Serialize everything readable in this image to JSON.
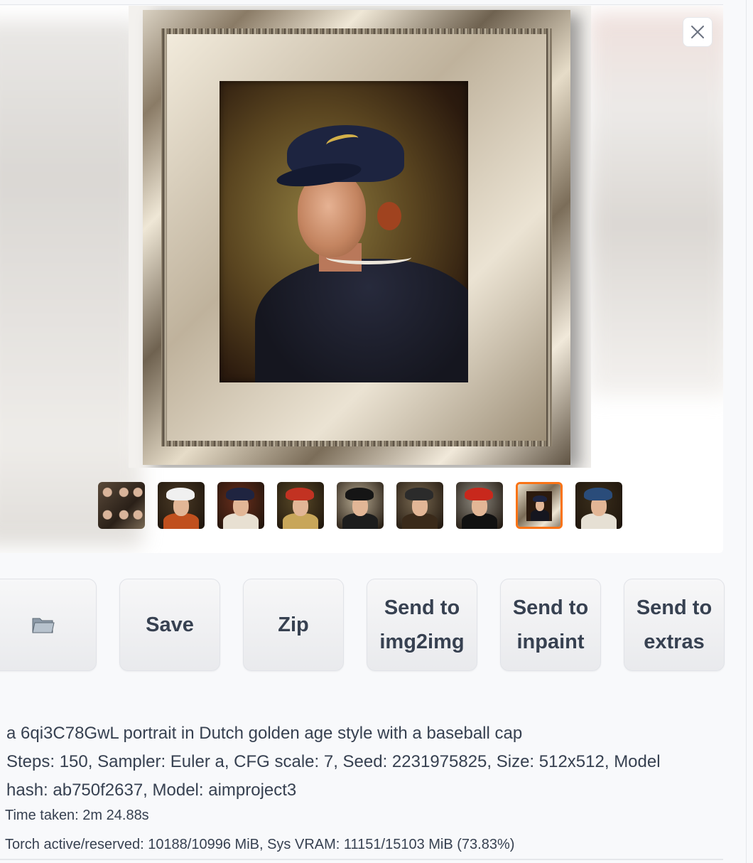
{
  "gallery": {
    "close_label": "close",
    "thumbnails": [
      {
        "kind": "grid",
        "hat_color": "",
        "body_color": "",
        "bg": "#3a2e22"
      },
      {
        "kind": "portrait",
        "hat_color": "#f0f0f0",
        "body_color": "#c0501e",
        "bg": "#4a3a26"
      },
      {
        "kind": "portrait",
        "hat_color": "#1f2440",
        "body_color": "#e8e0d2",
        "bg": "#6a2e1c"
      },
      {
        "kind": "portrait",
        "hat_color": "#c23222",
        "body_color": "#c8a65a",
        "bg": "#5a4a28"
      },
      {
        "kind": "portrait",
        "hat_color": "#151515",
        "body_color": "#1d1d1d",
        "bg": "#b8ab92"
      },
      {
        "kind": "portrait",
        "hat_color": "#2b2b2b",
        "body_color": "#3a2a1a",
        "bg": "#7a6a52"
      },
      {
        "kind": "portrait",
        "hat_color": "#c8281c",
        "body_color": "#111111",
        "bg": "#8e8a80"
      },
      {
        "kind": "frame",
        "hat_color": "#1d2440",
        "body_color": "#15161f",
        "bg": "#8a7b66",
        "selected": true
      },
      {
        "kind": "portrait",
        "hat_color": "#2a4c7a",
        "body_color": "#e6e0d4",
        "bg": "#3a2e1c"
      }
    ],
    "accent_color": "#f97316"
  },
  "actions": {
    "folder_icon": "folder-icon",
    "save": "Save",
    "zip": "Zip",
    "send_img2img": "Send to\nimg2img",
    "send_inpaint": "Send to\ninpaint",
    "send_extras": "Send to\nextras"
  },
  "info": {
    "prompt": "a 6qi3C78GwL portrait in Dutch golden age style with a baseball cap",
    "params": "Steps: 150, Sampler: Euler a, CFG scale: 7, Seed: 2231975825, Size: 512x512, Model hash: ab750f2637, Model: aimproject3",
    "time_taken": "Time taken: 2m 24.88s",
    "vram": "Torch active/reserved: 10188/10996 MiB, Sys VRAM: 11151/15103 MiB (73.83%)"
  }
}
